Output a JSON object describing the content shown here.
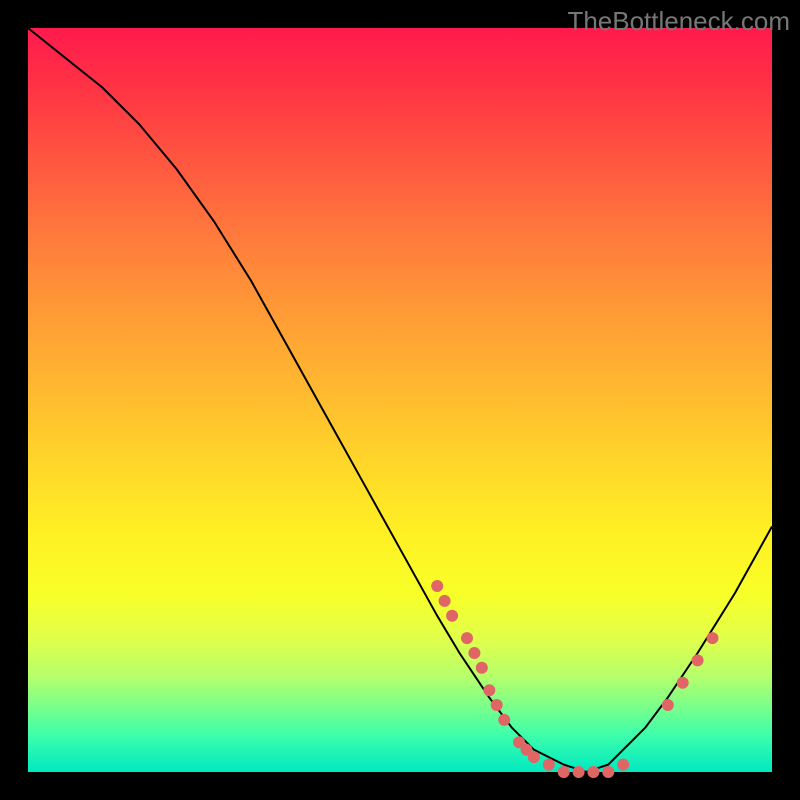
{
  "watermark": "TheBottleneck.com",
  "chart_data": {
    "type": "line",
    "title": "",
    "xlabel": "",
    "ylabel": "",
    "xlim": [
      0,
      100
    ],
    "ylim": [
      0,
      100
    ],
    "series": [
      {
        "name": "curve",
        "x": [
          0,
          5,
          10,
          15,
          20,
          25,
          30,
          35,
          40,
          45,
          50,
          55,
          58,
          60,
          62,
          65,
          68,
          70,
          72,
          75,
          78,
          80,
          83,
          86,
          90,
          95,
          100
        ],
        "y": [
          100,
          96,
          92,
          87,
          81,
          74,
          66,
          57,
          48,
          39,
          30,
          21,
          16,
          13,
          10,
          6,
          3,
          2,
          1,
          0,
          1,
          3,
          6,
          10,
          16,
          24,
          33
        ]
      }
    ],
    "points": [
      {
        "x": 55,
        "y": 25
      },
      {
        "x": 56,
        "y": 23
      },
      {
        "x": 57,
        "y": 21
      },
      {
        "x": 59,
        "y": 18
      },
      {
        "x": 60,
        "y": 16
      },
      {
        "x": 61,
        "y": 14
      },
      {
        "x": 62,
        "y": 11
      },
      {
        "x": 63,
        "y": 9
      },
      {
        "x": 64,
        "y": 7
      },
      {
        "x": 66,
        "y": 4
      },
      {
        "x": 67,
        "y": 3
      },
      {
        "x": 68,
        "y": 2
      },
      {
        "x": 70,
        "y": 1
      },
      {
        "x": 72,
        "y": 0
      },
      {
        "x": 74,
        "y": 0
      },
      {
        "x": 76,
        "y": 0
      },
      {
        "x": 78,
        "y": 0
      },
      {
        "x": 80,
        "y": 1
      },
      {
        "x": 86,
        "y": 9
      },
      {
        "x": 88,
        "y": 12
      },
      {
        "x": 90,
        "y": 15
      },
      {
        "x": 92,
        "y": 18
      }
    ],
    "colors": {
      "curve": "#000000",
      "point": "#e06666"
    }
  }
}
